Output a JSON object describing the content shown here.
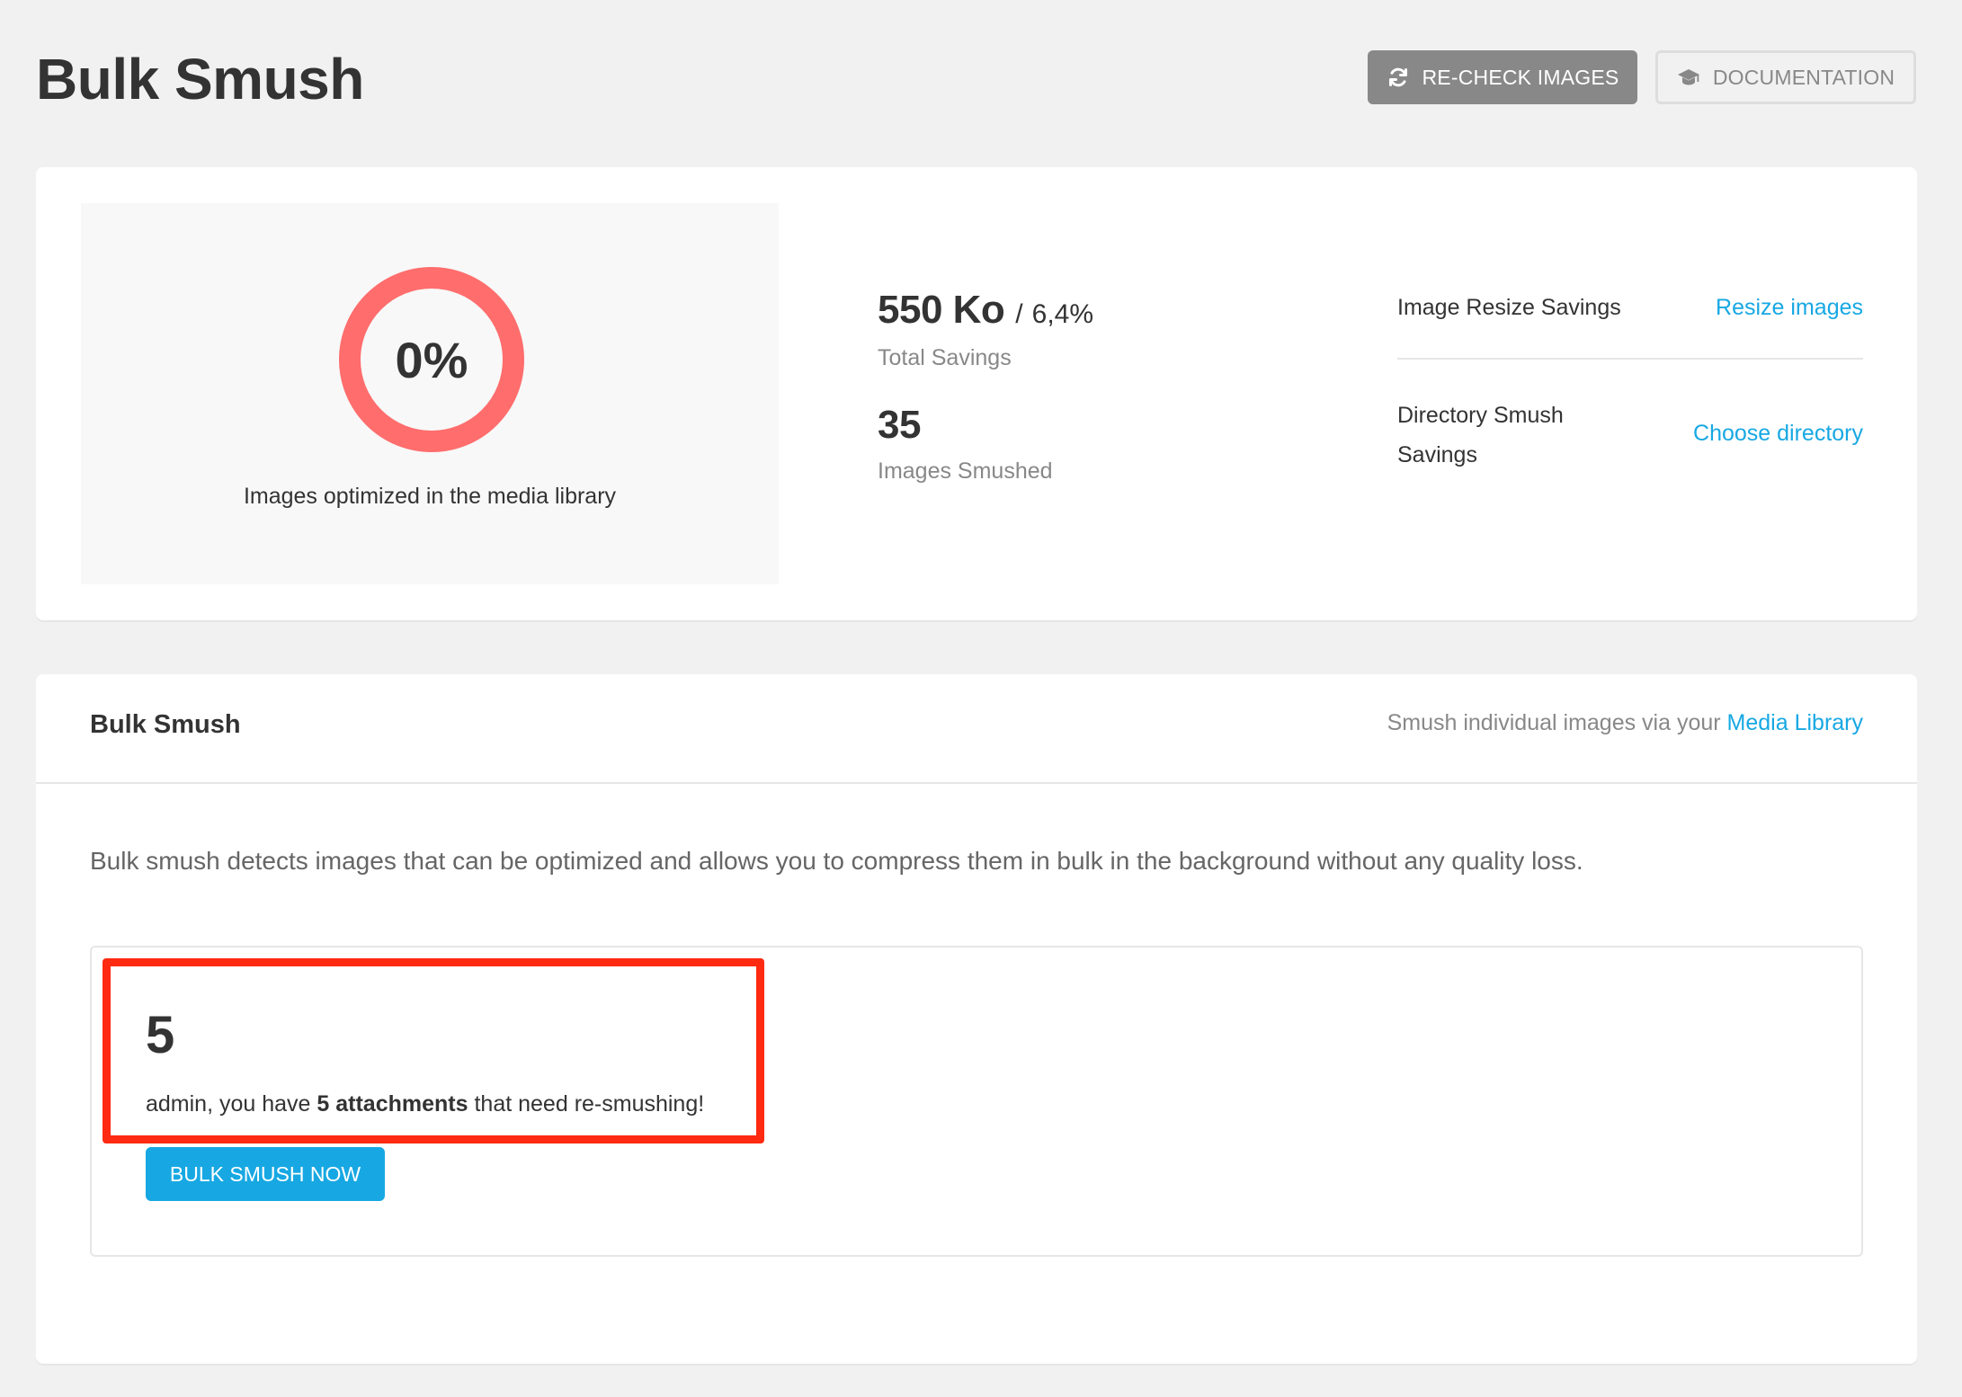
{
  "header": {
    "title": "Bulk Smush",
    "recheck_label": "RE-CHECK IMAGES",
    "docs_label": "DOCUMENTATION"
  },
  "summary": {
    "optimized_percent": "0%",
    "optimized_fraction": 0,
    "optimized_label": "Images optimized in the media library",
    "total_savings_size": "550 Ko",
    "total_savings_separator": "/",
    "total_savings_percent": "6,4%",
    "total_savings_label": "Total Savings",
    "images_smushed_count": "35",
    "images_smushed_label": "Images Smushed",
    "resize_savings_label": "Image Resize Savings",
    "resize_link": "Resize images",
    "directory_savings_label": "Directory Smush Savings",
    "directory_link": "Choose directory"
  },
  "bulk": {
    "title": "Bulk Smush",
    "hint_prefix": "Smush individual images via your",
    "hint_link": "Media Library",
    "description": "Bulk smush detects images that can be optimized and allows you to compress them in bulk in the background without any quality loss.",
    "remaining_count": "5",
    "message_prefix": "admin, you have",
    "message_bold": "5 attachments",
    "message_suffix": "that need re-smushing!",
    "button_label": "BULK SMUSH NOW"
  },
  "colors": {
    "accent": "#17a8e3",
    "ring": "#ff6d6d",
    "highlight": "#ff2a12",
    "page_bg": "#f1f1f1"
  },
  "icons": {
    "recheck": "refresh-icon",
    "docs": "graduation-cap-icon"
  }
}
